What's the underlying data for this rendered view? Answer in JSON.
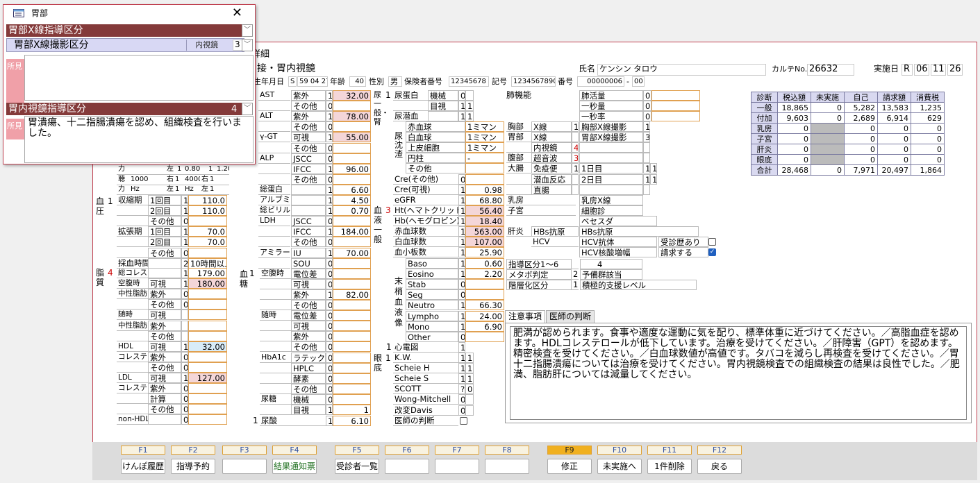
{
  "popup": {
    "title": "胃部",
    "row1_label": "胃部X線指導区分",
    "row2_label": "胃部X線撮影区分",
    "row2_value": "内視鏡",
    "row2_num": "3",
    "shoken_label": "所見",
    "row3_label": "胃内視鏡指導区分",
    "row3_num": "4",
    "shoken2": "胃潰瘍、十二指腸潰瘍を認め、組織検査を行いました。"
  },
  "window": {
    "title": "詳細",
    "subtitle": "接・胃内視鏡"
  },
  "header": {
    "name_label": "氏名",
    "name": "ケンシン タロウ",
    "karte_label": "カルテNo.",
    "karte": "26632",
    "jisshi_label": "実施日",
    "era": "R",
    "yy": "06",
    "mm": "11",
    "dd": "26",
    "dob_label": "生年月日",
    "dob_era": "S",
    "dob": "59 04 27",
    "age_label": "年齢",
    "age": "40",
    "sex_label": "性別",
    "sex": "男",
    "ins_label": "保険者番号",
    "ins": "12345678",
    "kigo_label": "記号",
    "kigo": "1234567890",
    "bango_label": "番号",
    "bango": "00000006",
    "bango2": "00"
  },
  "liver": [
    {
      "name": "AST",
      "method": "紫外",
      "flag": "1",
      "value": "32.00",
      "pink": true
    },
    {
      "name": "",
      "method": "その他",
      "flag": "0",
      "value": ""
    },
    {
      "name": "ALT",
      "method": "紫外",
      "flag": "1",
      "value": "78.00",
      "pink": true
    },
    {
      "name": "",
      "method": "その他",
      "flag": "0",
      "value": ""
    },
    {
      "name": "γ-GT",
      "method": "可視",
      "flag": "1",
      "value": "55.00",
      "pink": true
    },
    {
      "name": "",
      "method": "その他",
      "flag": "0",
      "value": ""
    },
    {
      "name": "ALP",
      "method": "JSCC",
      "flag": "0",
      "value": ""
    },
    {
      "name": "",
      "method": "IFCC",
      "flag": "1",
      "value": "96.00"
    },
    {
      "name": "",
      "method": "その他",
      "flag": "0",
      "value": ""
    },
    {
      "name": "総蛋白",
      "method": "",
      "flag": "1",
      "value": "6.60"
    },
    {
      "name": "アルブミン",
      "method": "",
      "flag": "1",
      "value": "4.50"
    },
    {
      "name": "総ビリルビン",
      "method": "",
      "flag": "1",
      "value": "0.70"
    },
    {
      "name": "LDH",
      "method": "JSCC",
      "flag": "0",
      "value": ""
    },
    {
      "name": "",
      "method": "IFCC",
      "flag": "1",
      "value": "184.00"
    },
    {
      "name": "",
      "method": "その他",
      "flag": "0",
      "value": ""
    },
    {
      "name": "アミラーゼ",
      "method": "IU",
      "flag": "1",
      "value": "70.00"
    },
    {
      "name": "",
      "method": "SOU",
      "flag": "0",
      "value": ""
    }
  ],
  "sugar": [
    {
      "name": "空腹時",
      "method": "電位差",
      "flag": "0",
      "value": ""
    },
    {
      "name": "",
      "method": "可視",
      "flag": "0",
      "value": ""
    },
    {
      "name": "",
      "method": "紫外",
      "flag": "1",
      "value": "82.00"
    },
    {
      "name": "",
      "method": "その他",
      "flag": "0",
      "value": ""
    },
    {
      "name": "随時",
      "method": "電位差",
      "flag": "0",
      "value": ""
    },
    {
      "name": "",
      "method": "可視",
      "flag": "0",
      "value": ""
    },
    {
      "name": "",
      "method": "紫外",
      "flag": "0",
      "value": ""
    },
    {
      "name": "",
      "method": "その他",
      "flag": "0",
      "value": ""
    },
    {
      "name": "HbA1c",
      "method": "ラテックス",
      "flag": "0",
      "value": ""
    },
    {
      "name": "",
      "method": "HPLC",
      "flag": "0",
      "value": ""
    },
    {
      "name": "",
      "method": "酵素",
      "flag": "0",
      "value": ""
    },
    {
      "name": "",
      "method": "その他",
      "flag": "0",
      "value": ""
    },
    {
      "name": "尿糖",
      "method": "機械",
      "flag": "0",
      "value": ""
    },
    {
      "name": "",
      "method": "目視",
      "flag": "1",
      "value": "1"
    }
  ],
  "sugar_label": "血糖",
  "sugar_flag": "1",
  "uric": {
    "flag": "1",
    "name": "尿酸",
    "value": "6.10"
  },
  "urine": {
    "cat": "尿一般・腎",
    "flag": "1",
    "rows": [
      {
        "name": "尿蛋白",
        "method": "機械",
        "flag": "0",
        "value": ""
      },
      {
        "name": "",
        "method": "目視",
        "flag": "1",
        "value": "1"
      },
      {
        "name": "尿潜血",
        "method": "",
        "flag": "1",
        "value": "1"
      }
    ],
    "sed_label": "尿沈渣",
    "sed": [
      {
        "name": "赤血球",
        "value": "1ミマン"
      },
      {
        "name": "白血球",
        "value": "1ミマン"
      },
      {
        "name": "上皮細胞",
        "value": "1ミマン"
      },
      {
        "name": "円柱",
        "value": "-"
      },
      {
        "name": "その他",
        "value": ""
      }
    ],
    "cre": [
      {
        "name": "Cre(その他)",
        "flag": "0",
        "value": ""
      },
      {
        "name": "Cre(可視)",
        "flag": "1",
        "value": "0.98"
      },
      {
        "name": "eGFR",
        "flag": "1",
        "value": "68.80"
      }
    ]
  },
  "blood": {
    "cat": "血液一般",
    "flag": "3",
    "rows": [
      {
        "name": "Ht(ヘマトクリット)",
        "flag": "1",
        "value": "56.40",
        "pink": true
      },
      {
        "name": "Hb(ヘモグロビン)",
        "flag": "1",
        "value": "18.40",
        "pink": true
      },
      {
        "name": "赤血球数",
        "flag": "1",
        "value": "563.00",
        "pink": true
      },
      {
        "name": "白血球数",
        "flag": "1",
        "value": "107.00",
        "pink": true
      },
      {
        "name": "血小板数",
        "flag": "1",
        "value": "25.90"
      }
    ],
    "diff_label": "末梢血液像",
    "diff": [
      {
        "name": "Baso",
        "flag": "1",
        "value": "0.60"
      },
      {
        "name": "Eosino",
        "flag": "1",
        "value": "2.20"
      },
      {
        "name": "Stab",
        "flag": "0",
        "value": ""
      },
      {
        "name": "Seg",
        "flag": "0",
        "value": ""
      },
      {
        "name": "Neutro",
        "flag": "1",
        "value": "66.30"
      },
      {
        "name": "Lympho",
        "flag": "1",
        "value": "24.00"
      },
      {
        "name": "Mono",
        "flag": "1",
        "value": "6.90"
      },
      {
        "name": "Other",
        "flag": "0",
        "value": ""
      }
    ]
  },
  "ecg": {
    "flag": "1",
    "name": "心電図",
    "value": "1"
  },
  "eye": {
    "cat": "眼底",
    "flag": "1",
    "rows": [
      {
        "name": "K.W.",
        "a": "1",
        "b": "1"
      },
      {
        "name": "Scheie H",
        "a": "1",
        "b": "1"
      },
      {
        "name": "Scheie S",
        "a": "1",
        "b": "1"
      },
      {
        "name": "SCOTT",
        "a": "?",
        "b": "0"
      },
      {
        "name": "Wong-Mitchell",
        "a": "0",
        "b": ""
      },
      {
        "name": "改変Davis",
        "a": "0",
        "b": ""
      },
      {
        "name": "医師の判断",
        "a": "",
        "b": ""
      }
    ]
  },
  "bp": {
    "label": "血圧",
    "flag": "1",
    "rows": [
      {
        "grp": "収縮期",
        "name": "1回目",
        "flag": "1",
        "value": "110.0"
      },
      {
        "grp": "",
        "name": "2回目",
        "flag": "1",
        "value": "110.0"
      },
      {
        "grp": "",
        "name": "その他",
        "flag": "0",
        "value": ""
      },
      {
        "grp": "拡張期",
        "name": "1回目",
        "flag": "1",
        "value": "70.0"
      },
      {
        "grp": "",
        "name": "2回目",
        "flag": "1",
        "value": "70.0"
      },
      {
        "grp": "",
        "name": "その他",
        "flag": "0",
        "value": ""
      },
      {
        "grp": "採血時間",
        "name": "",
        "flag": "2",
        "value": "10時間以上"
      }
    ]
  },
  "lipid": {
    "label": "脂質",
    "flag": "4",
    "rows": [
      {
        "grp": "総コレステロール",
        "name": "",
        "flag": "1",
        "value": "179.00"
      },
      {
        "grp": "空腹時",
        "name": "可視",
        "flag": "1",
        "value": "180.00",
        "pink": true
      },
      {
        "grp": "中性脂肪",
        "name": "紫外",
        "flag": "0",
        "value": ""
      },
      {
        "grp": "",
        "name": "その他",
        "flag": "0",
        "value": ""
      },
      {
        "grp": "随時",
        "name": "可視",
        "flag": "",
        "value": ""
      },
      {
        "grp": "中性脂肪",
        "name": "紫外",
        "flag": "",
        "value": ""
      },
      {
        "grp": "",
        "name": "その他",
        "flag": "",
        "value": ""
      },
      {
        "grp": "HDL",
        "name": "可視",
        "flag": "1",
        "value": "32.00",
        "blue": true
      },
      {
        "grp": "コレステロール",
        "name": "紫外",
        "flag": "0",
        "value": ""
      },
      {
        "grp": "",
        "name": "その他",
        "flag": "0",
        "value": ""
      },
      {
        "grp": "LDL",
        "name": "可視",
        "flag": "1",
        "value": "127.00",
        "pink": true
      },
      {
        "grp": "コレステロール",
        "name": "紫外",
        "flag": "0",
        "value": ""
      },
      {
        "grp": "",
        "name": "計算",
        "flag": "0",
        "value": ""
      },
      {
        "grp": "",
        "name": "その他",
        "flag": "0",
        "value": ""
      },
      {
        "grp": "non-HDL",
        "name": "",
        "flag": "0",
        "value": ""
      }
    ]
  },
  "hearing": {
    "r1": [
      "力",
      "左",
      "1",
      "0.80",
      "1",
      "1.20"
    ],
    "r2": [
      "聴",
      "1000",
      "右",
      "1",
      "4000",
      "右",
      "1"
    ],
    "r3": [
      "力",
      "Hz",
      "左",
      "1",
      "Hz",
      "左",
      "1"
    ]
  },
  "lung": {
    "label": "肺機能",
    "rows": [
      {
        "name": "肺活量",
        "flag": "0"
      },
      {
        "name": "一秒量",
        "flag": "0"
      },
      {
        "name": "一秒率",
        "flag": "0"
      }
    ]
  },
  "xray": [
    {
      "grp": "胸部",
      "name": "X線",
      "flag": "1",
      "name2": "胸部X線撮影",
      "flag2": "1"
    },
    {
      "grp": "胃部",
      "name": "X線",
      "flag": "",
      "name2": "胃部X線撮影",
      "flag2": "3"
    },
    {
      "grp": "",
      "name": "内視鏡",
      "flag": "4",
      "name2": "",
      "flag2": ""
    },
    {
      "grp": "腹部",
      "name": "超音波",
      "flag": "3",
      "name2": "",
      "flag2": ""
    },
    {
      "grp": "大腸",
      "name": "免疫便",
      "flag": "1",
      "name2": "1日目",
      "flag2": "1",
      "flag3": "1"
    },
    {
      "grp": "",
      "name": "潜血反応",
      "flag": "",
      "name2": "2日目",
      "flag2": "1",
      "flag3": "1"
    },
    {
      "grp": "",
      "name": "直腸",
      "flag": "",
      "name2": "",
      "flag2": ""
    }
  ],
  "breast": {
    "grp": "乳房",
    "name": "乳房X線"
  },
  "uterus": {
    "grp": "子宮",
    "r1": "細胞診",
    "r2": "ベセスダ"
  },
  "hep": {
    "grp": "肝炎",
    "hbs": "HBs抗原",
    "hbs2": "HBs抗原",
    "hcv": "HCV",
    "hcv1": "HCV抗体",
    "hcv2": "HCV核酸増幅",
    "hist": "受診歴あり",
    "req": "請求する"
  },
  "guide": [
    {
      "name": "指導区分1～6",
      "flag": "",
      "value": "4"
    },
    {
      "name": "メタボ判定",
      "flag": "2",
      "value": "予備群該当"
    },
    {
      "name": "階層化区分",
      "flag": "1",
      "value": "積極的支援レベル"
    }
  ],
  "summary": {
    "headers": [
      "診断",
      "税込額",
      "未実施",
      "自己",
      "請求額",
      "消費税"
    ],
    "rows": [
      [
        "一般",
        "18,865",
        "0",
        "5,282",
        "13,583",
        "1,235"
      ],
      [
        "付加",
        "9,603",
        "0",
        "2,689",
        "6,914",
        "629"
      ],
      [
        "乳房",
        "0",
        "",
        "0",
        "0",
        "0"
      ],
      [
        "子宮",
        "0",
        "",
        "0",
        "0",
        "0"
      ],
      [
        "肝炎",
        "0",
        "",
        "0",
        "0",
        "0"
      ],
      [
        "眼底",
        "0",
        "",
        "0",
        "0",
        "0"
      ],
      [
        "合計",
        "28,468",
        "0",
        "7,971",
        "20,497",
        "1,864"
      ]
    ]
  },
  "tabs": [
    "注意事項",
    "医師の判断"
  ],
  "notes": "肥満が認められます。食事や適度な運動に気を配り、標準体重に近づけてください。／高脂血症を認めます。HDLコレステロールが低下しています。治療を受けてください。／肝障害（GPT）を認めます。精密検査を受けてください。／白血球数値が高値です。タバコを減らし再検査を受けてください。／胃十二指腸潰瘍については治療を受けてください。胃内視鏡検査での組織検査の結果は良性でした。／肥満、脂肪肝については減量してください。",
  "fkeys": [
    {
      "k": "F1",
      "l": "けんぽ履歴"
    },
    {
      "k": "F2",
      "l": "指導予約"
    },
    {
      "k": "F3",
      "l": ""
    },
    {
      "k": "F4",
      "l": "結果通知票"
    },
    {
      "k": "F5",
      "l": "受診者一覧"
    },
    {
      "k": "F6",
      "l": ""
    },
    {
      "k": "F7",
      "l": ""
    },
    {
      "k": "F8",
      "l": ""
    },
    {
      "k": "F9",
      "l": "修正"
    },
    {
      "k": "F10",
      "l": "未実施へ"
    },
    {
      "k": "F11",
      "l": "1件削除"
    },
    {
      "k": "F12",
      "l": "戻る"
    }
  ]
}
